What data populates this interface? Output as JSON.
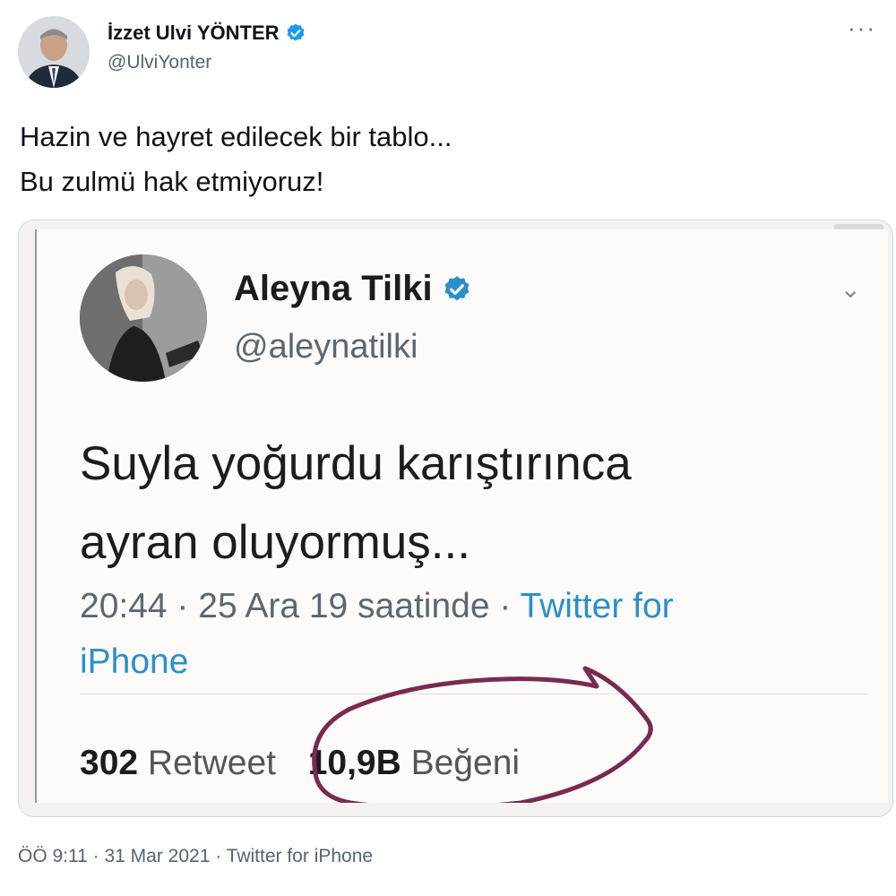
{
  "tweet": {
    "author_name": "İzzet Ulvi YÖNTER",
    "handle": "@UlviYonter",
    "text_lines": [
      "Hazin ve hayret edilecek bir tablo...",
      "Bu zulmü hak etmiyoruz!"
    ],
    "timestamp": "ÖÖ 9:11 · 31 Mar 2021 · Twitter for iPhone",
    "more_icon": "more-horizontal-icon",
    "verified_icon": "verified-badge-icon"
  },
  "embedded_tweet": {
    "author_name": "Aleyna Tilki",
    "handle": "@aleynatilki",
    "text_lines": [
      "Suyla yoğurdu karıştırınca",
      "ayran oluyormuş..."
    ],
    "meta_prefix": "20:44 · 25 Ara 19 saatinde · ",
    "meta_source_line1": "Twitter for",
    "meta_source_line2": "iPhone",
    "retweet_count": "302",
    "retweet_label": "Retweet",
    "like_count": "10,9B",
    "like_label": "Beğeni",
    "chevron_icon": "chevron-down-icon"
  },
  "colors": {
    "accent": "#1d9bf0",
    "annotation": "#7a2a4e",
    "secondary_text": "#536471"
  }
}
